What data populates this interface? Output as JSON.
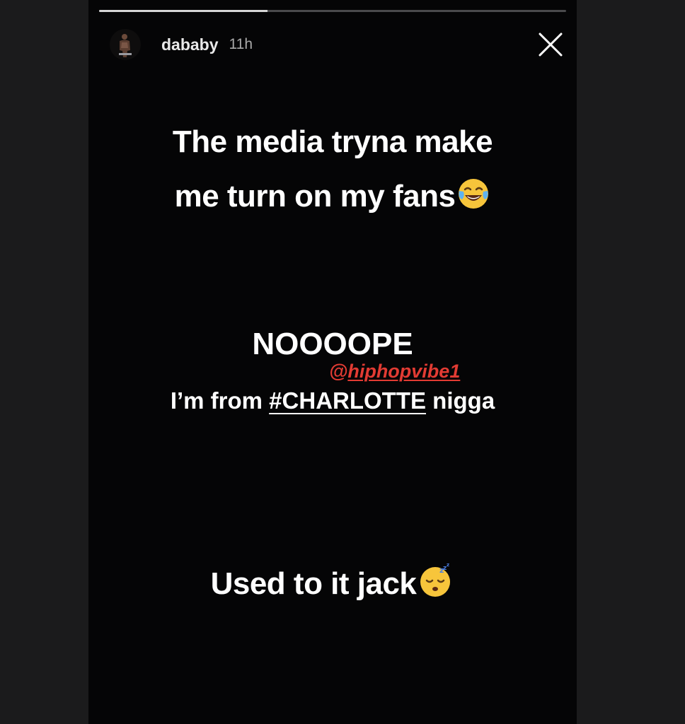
{
  "story": {
    "progress_fraction": 0.36,
    "header": {
      "username": "dababy",
      "timestamp": "11h",
      "avatar_icon": "user-avatar",
      "close_icon": "close-icon"
    },
    "text": {
      "line1": "The media tryna make",
      "line2": "me turn on my fans",
      "line3": "NOOOOPE",
      "line4_before": "I’m from ",
      "line4_hashtag": "#CHARLOTTE",
      "line4_after": " nigga",
      "line5": "Used to it jack"
    },
    "watermark": {
      "at": "@",
      "handle": "hiphopvibe1"
    },
    "emojis": {
      "laughing": "face-with-tears-of-joy-emoji",
      "sleeping": "sleeping-face-emoji"
    },
    "colors": {
      "background": "#050506",
      "text": "#ffffff",
      "watermark": "#e23b33"
    }
  }
}
